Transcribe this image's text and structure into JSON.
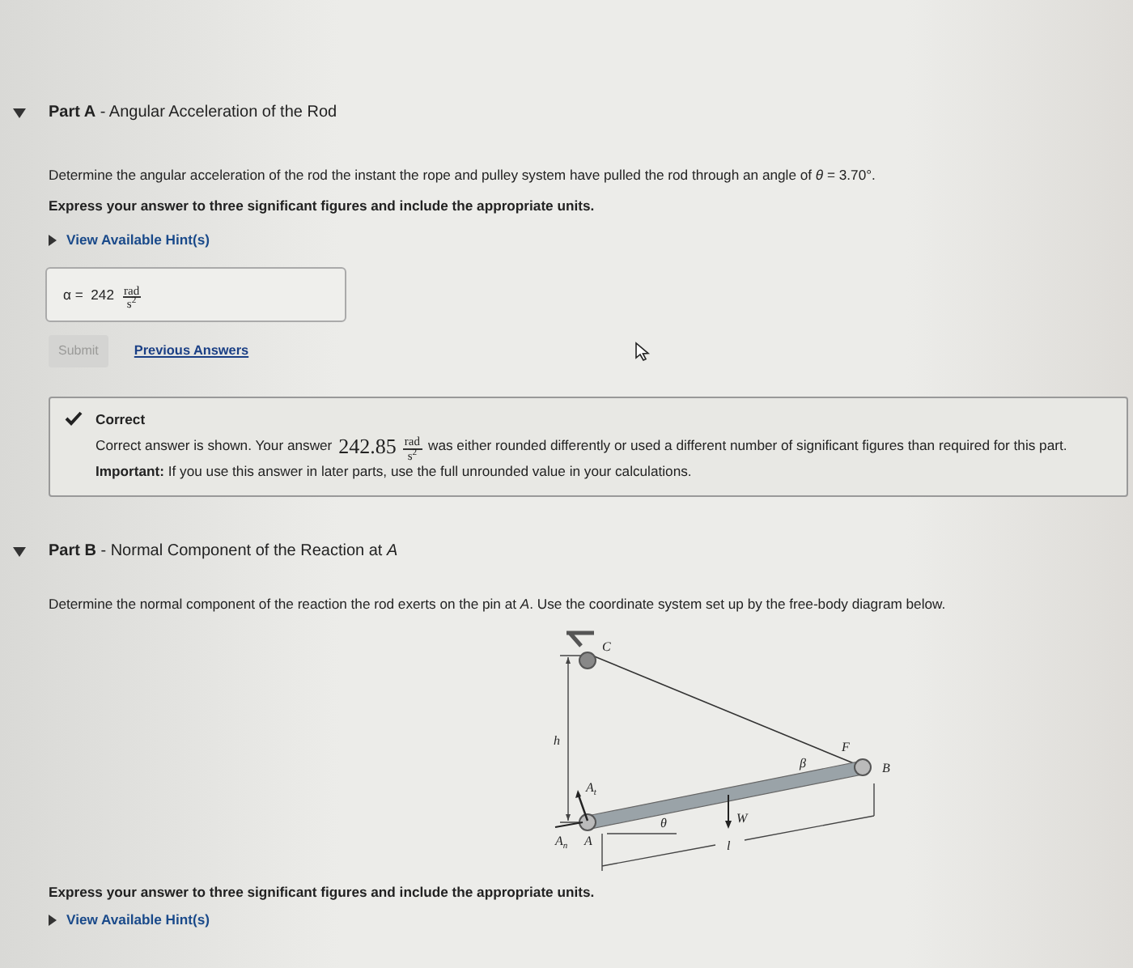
{
  "part_a": {
    "expanded": true,
    "heading": "**Part A** - Angular Acceleration of the Rod",
    "question": "Determine the angular acceleration of the rod the instant the rope and pulley system have pulled the rod through an angle of *θ* = 3.70°.",
    "instruction": "Express your answer to three significant figures and include the appropriate units.",
    "hint_link": "View Available Hint(s)",
    "answer": {
      "symbol": "α =",
      "value": "242",
      "unit_top": "rad",
      "unit_bottom": "s$^{2}$"
    },
    "submit": {
      "label": "Submit",
      "disabled": true
    },
    "previous_link": "Previous Answers",
    "feedback": {
      "title": "Correct",
      "lead": "Correct answer is shown. Your answer",
      "value": "242.85",
      "unit_top": "rad",
      "unit_bottom": "s$^{2}$",
      "tail": "was either rounded differently or used a different number of significant figures than required for this part.",
      "note": "**Important:** If you use this answer in later parts, use the full unrounded value in your calculations."
    }
  },
  "part_b": {
    "expanded": true,
    "heading": "**Part B** - Normal Component of the Reaction at *A*",
    "question": "Determine the normal component of the reaction the rod exerts on the pin at *A*. Use the coordinate system set up by the free-body diagram below.",
    "diagram_labels": [
      {
        "text": "C"
      },
      {
        "text": "h"
      },
      {
        "text": "A",
        "sub": "t"
      },
      {
        "text": "A",
        "sub": "n"
      },
      {
        "text": "A"
      },
      {
        "text": "θ"
      },
      {
        "text": "W"
      },
      {
        "text": "l"
      },
      {
        "text": "F"
      },
      {
        "text": "β"
      },
      {
        "text": "B"
      }
    ],
    "instruction": "Express your answer to three significant figures and include the appropriate units.",
    "hint_link": "View Available Hint(s)"
  }
}
